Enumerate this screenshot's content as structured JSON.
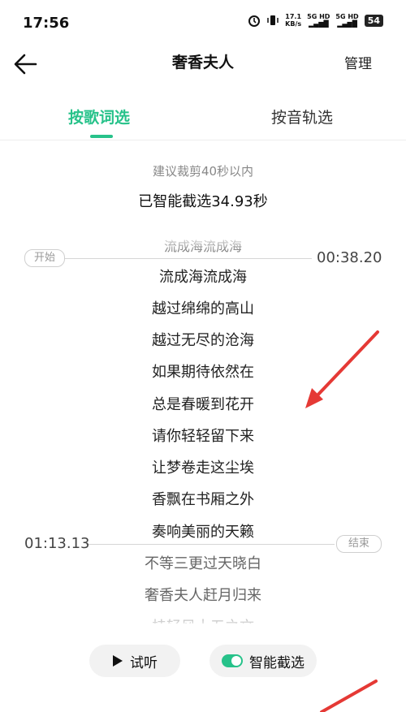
{
  "status_bar": {
    "time": "17:56",
    "net_speed_value": "17.1",
    "net_speed_unit": "KB/s",
    "sim1": "5G HD",
    "sim2": "5G HD",
    "battery": "54"
  },
  "nav": {
    "title": "奢香夫人",
    "manage_label": "管理"
  },
  "tabs": [
    {
      "label": "按歌词选",
      "active": true
    },
    {
      "label": "按音轨选",
      "active": false
    }
  ],
  "info": {
    "hint": "建议裁剪40秒以内",
    "smart_selected": "已智能截选34.93秒"
  },
  "markers": {
    "start_label": "开始",
    "start_time": "00:38.20",
    "end_label": "结束",
    "end_time": "01:13.13"
  },
  "lyrics": [
    "流成海流成海",
    "流成海流成海",
    "越过绵绵的高山",
    "越过无尽的沧海",
    "如果期待依然在",
    "总是春暖到花开",
    "请你轻轻留下来",
    "让梦卷走这尘埃",
    "香飘在书厢之外",
    "奏响美丽的天籁",
    "不等三更过天晓白",
    "奢香夫人赶月归来",
    "桂轻风十五之文"
  ],
  "buttons": {
    "play_label": "试听",
    "smart_label": "智能截选"
  },
  "colors": {
    "accent": "#27c28a",
    "annotation_arrow": "#e53935"
  }
}
